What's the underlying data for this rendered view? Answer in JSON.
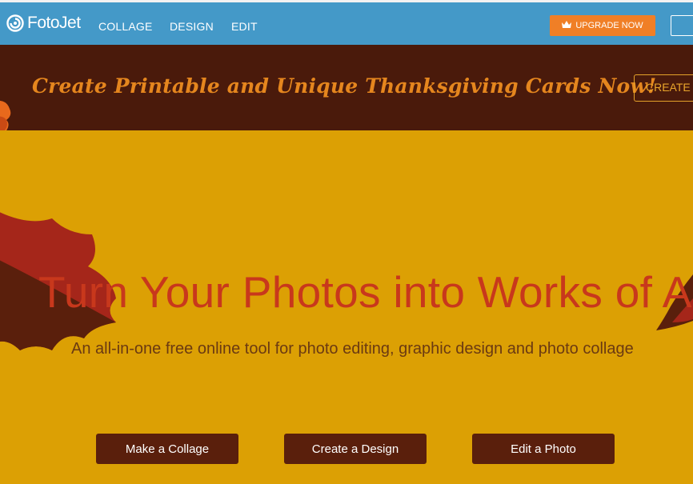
{
  "nav": {
    "logo_text": "FotoJet",
    "links": [
      "COLLAGE",
      "DESIGN",
      "EDIT"
    ],
    "upgrade_label": "UPGRADE NOW"
  },
  "banner": {
    "text": "Create Printable and Unique Thanksgiving Cards Now!",
    "button_label": "CREATE"
  },
  "hero": {
    "title": "Turn Your Photos into Works of A",
    "subtitle": "An all-in-one free online tool for photo editing, graphic design and photo collage",
    "buttons": [
      "Make a Collage",
      "Create a Design",
      "Edit a Photo"
    ]
  },
  "colors": {
    "nav_bg": "#4499c8",
    "upgrade_bg": "#f07f26",
    "banner_bg": "#4a1a0b",
    "banner_text": "#e5861e",
    "hero_bg": "#dca004",
    "hero_title": "#c8381c",
    "button_bg": "#5a1f0c"
  },
  "icons": {
    "logo": "fotojet-spiral-icon",
    "upgrade": "crown-icon"
  }
}
